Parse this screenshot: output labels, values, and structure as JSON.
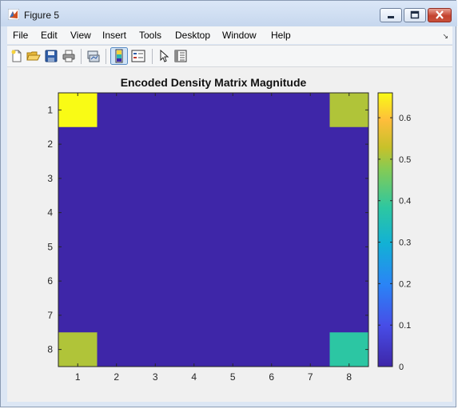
{
  "window": {
    "title": "Figure 5",
    "menu": [
      "File",
      "Edit",
      "View",
      "Insert",
      "Tools",
      "Desktop",
      "Window",
      "Help"
    ],
    "dock_glyph": "↘"
  },
  "toolbar": {
    "buttons": [
      "new-figure-icon",
      "open-file-icon",
      "save-icon",
      "print-icon",
      "link-plot-icon",
      "insert-colorbar-icon",
      "insert-legend-icon",
      "pointer-icon",
      "property-inspector-icon"
    ]
  },
  "chart_data": {
    "type": "heatmap",
    "title": "Encoded Density Matrix Magnitude",
    "x_ticks": [
      "1",
      "2",
      "3",
      "4",
      "5",
      "6",
      "7",
      "8"
    ],
    "y_ticks": [
      "1",
      "2",
      "3",
      "4",
      "5",
      "6",
      "7",
      "8"
    ],
    "values": [
      [
        0.66,
        0,
        0,
        0,
        0,
        0,
        0,
        0.51
      ],
      [
        0,
        0,
        0,
        0,
        0,
        0,
        0,
        0
      ],
      [
        0,
        0,
        0,
        0,
        0,
        0,
        0,
        0
      ],
      [
        0,
        0,
        0,
        0,
        0,
        0,
        0,
        0
      ],
      [
        0,
        0,
        0,
        0,
        0,
        0,
        0,
        0
      ],
      [
        0,
        0,
        0,
        0,
        0,
        0,
        0,
        0
      ],
      [
        0,
        0,
        0,
        0,
        0,
        0,
        0,
        0
      ],
      [
        0.51,
        0,
        0,
        0,
        0,
        0,
        0,
        0.38
      ]
    ],
    "colorbar": {
      "limits": [
        0,
        0.66
      ],
      "ticks": [
        0,
        0.1,
        0.2,
        0.3,
        0.4,
        0.5,
        0.6
      ],
      "tick_labels": [
        "0",
        "0.1",
        "0.2",
        "0.3",
        "0.4",
        "0.5",
        "0.6"
      ],
      "colormap": "parula"
    }
  }
}
